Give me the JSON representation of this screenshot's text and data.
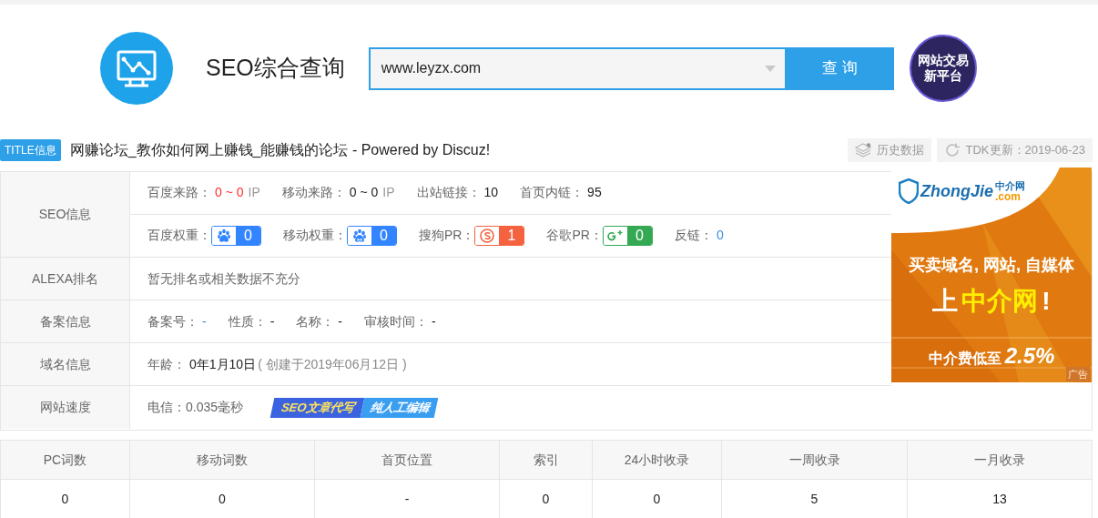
{
  "header": {
    "title": "SEO综合查询",
    "search": {
      "value": "www.leyzx.com"
    },
    "search_button": "查 询",
    "promo_lines": [
      "网站交易",
      "新平台"
    ]
  },
  "title_row": {
    "badge": "TITLE信息",
    "text": "网赚论坛_教你如何网上赚钱_能赚钱的论坛 - Powered by Discuz!",
    "actions": [
      {
        "kind": "history",
        "label": "历史数据"
      },
      {
        "kind": "refresh",
        "label": "TDK更新：2019-06-23"
      }
    ]
  },
  "info_rows": [
    {
      "label": "SEO信息",
      "lines": [
        [
          {
            "kind": "pair",
            "label": "百度来路：",
            "value": "0 ~ 0",
            "color": "#ff2c2c",
            "unit": "IP"
          },
          {
            "kind": "pair",
            "label": "移动来路：",
            "value": "0 ~ 0",
            "color": "#222222",
            "unit": "IP"
          },
          {
            "kind": "pair",
            "label": "出站链接：",
            "value": "10",
            "color": "#222222"
          },
          {
            "kind": "pair",
            "label": "首页内链：",
            "value": "95",
            "color": "#222222"
          }
        ],
        [
          {
            "kind": "baidu",
            "label": "百度权重：",
            "value": "0"
          },
          {
            "kind": "mobile",
            "label": "移动权重：",
            "value": "0"
          },
          {
            "kind": "sogou",
            "label": "搜狗PR：",
            "value": "1"
          },
          {
            "kind": "google",
            "label": "谷歌PR：",
            "value": "0"
          },
          {
            "kind": "pair",
            "label": "反链：",
            "value": "0",
            "color": "#3a8ee6"
          }
        ]
      ]
    },
    {
      "label": "ALEXA排名",
      "lines": [
        [
          {
            "kind": "text",
            "text": "暂无排名或相关数据不充分"
          }
        ]
      ]
    },
    {
      "label": "备案信息",
      "lines": [
        [
          {
            "kind": "pair",
            "label": "备案号：",
            "value": "-",
            "color": "#3a8ee6"
          },
          {
            "kind": "pair",
            "label": "性质：",
            "value": "-"
          },
          {
            "kind": "pair",
            "label": "名称：",
            "value": "-"
          },
          {
            "kind": "pair",
            "label": "审核时间：",
            "value": "-"
          }
        ]
      ]
    },
    {
      "label": "域名信息",
      "lines": [
        [
          {
            "kind": "pair",
            "label": "年龄：",
            "value": "0年1月10日",
            "color": "#222222",
            "note": "( 创建于2019年06月12日 )"
          }
        ]
      ]
    },
    {
      "label": "网站速度",
      "lines": [
        [
          {
            "kind": "text",
            "text": "电信：0.035毫秒"
          },
          {
            "kind": "promo",
            "parts": [
              "SEO文章代写",
              "纯人工编辑"
            ]
          }
        ]
      ]
    }
  ],
  "ad": {
    "logo": "ZhongJie",
    "logo_suffix": ".com",
    "logo_cn": "中介网",
    "line1": "买卖域名, 网站, 自媒体",
    "headline": [
      "上",
      "中介网",
      "!"
    ],
    "fee": "中介费低至",
    "rate": "2.5%",
    "tag": "广告"
  },
  "stats": {
    "columns": [
      "PC词数",
      "移动词数",
      "首页位置",
      "索引",
      "24小时收录",
      "一周收录",
      "一月收录"
    ],
    "rows": [
      [
        "0",
        "0",
        "-",
        "0",
        "0",
        "5",
        "13"
      ]
    ]
  }
}
